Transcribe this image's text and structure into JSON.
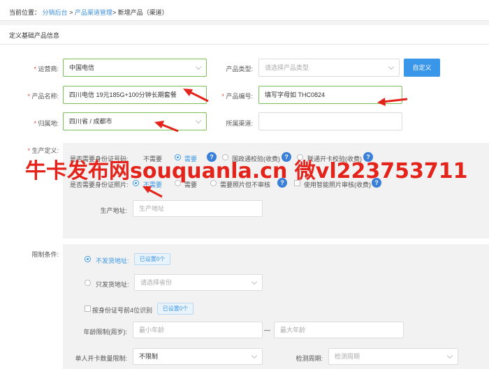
{
  "breadcrumb": {
    "prefix": "当前位置：",
    "item1": "分销后台",
    "sep1": ">",
    "item2": "产品渠道管理",
    "sep2": ">",
    "current": "新增产品（渠道）"
  },
  "section_title": "定义基础产品信息",
  "form": {
    "carrier_label": "运营商:",
    "carrier_value": "中国电信",
    "product_type_label": "产品类型:",
    "product_type_placeholder": "请选择产品类型",
    "custom_button": "自定义",
    "product_name_label": "产品名称:",
    "product_name_value": "四川电信 19元185G+100分钟长期套餐",
    "product_code_label": "产品编号:",
    "product_code_value": "填写字母如  THC0824",
    "region_label": "归属地:",
    "region_value": "四川省 / 成都市",
    "channel_label": "所属渠道:",
    "channel_value": ""
  },
  "production": {
    "label": "生产定义:",
    "id_number_label": "是否需要身份证号码:",
    "id_number_options": [
      "不需要",
      "需要",
      "国政通校验(收费)",
      "联通开卡校验(收费)"
    ],
    "id_photo_label": "是否需要身份证照片:",
    "id_photo_options": [
      "不需要",
      "需要",
      "需要照片但不审核",
      "使用智能照片审核(收费)"
    ],
    "address_label": "生产地址:",
    "address_placeholder": "生产地址"
  },
  "limits": {
    "label": "限制条件:",
    "no_ship_label": "不发货地址:",
    "no_ship_tag": "已设置0个",
    "only_ship_label": "只发货地址:",
    "only_ship_placeholder": "请选择省份",
    "id_prefix_label": "按身份证号前4位识别",
    "id_prefix_tag": "已设置0个",
    "age_label": "年龄限制(周岁):",
    "age_min_placeholder": "最小年龄",
    "age_dash": "—",
    "age_max_placeholder": "最大年龄",
    "card_limit_label": "单人开卡数量限制:",
    "card_limit_value": "不限制",
    "check_period_label": "检测周期:",
    "check_period_placeholder": "检测周期"
  },
  "watermark": "牛卡发布网souquanla.cn  微vl223753711",
  "colors": {
    "accent": "#3a96e8",
    "required": "#e04a3b",
    "valid_border": "#7cc05b",
    "watermark": "#e4231b"
  }
}
